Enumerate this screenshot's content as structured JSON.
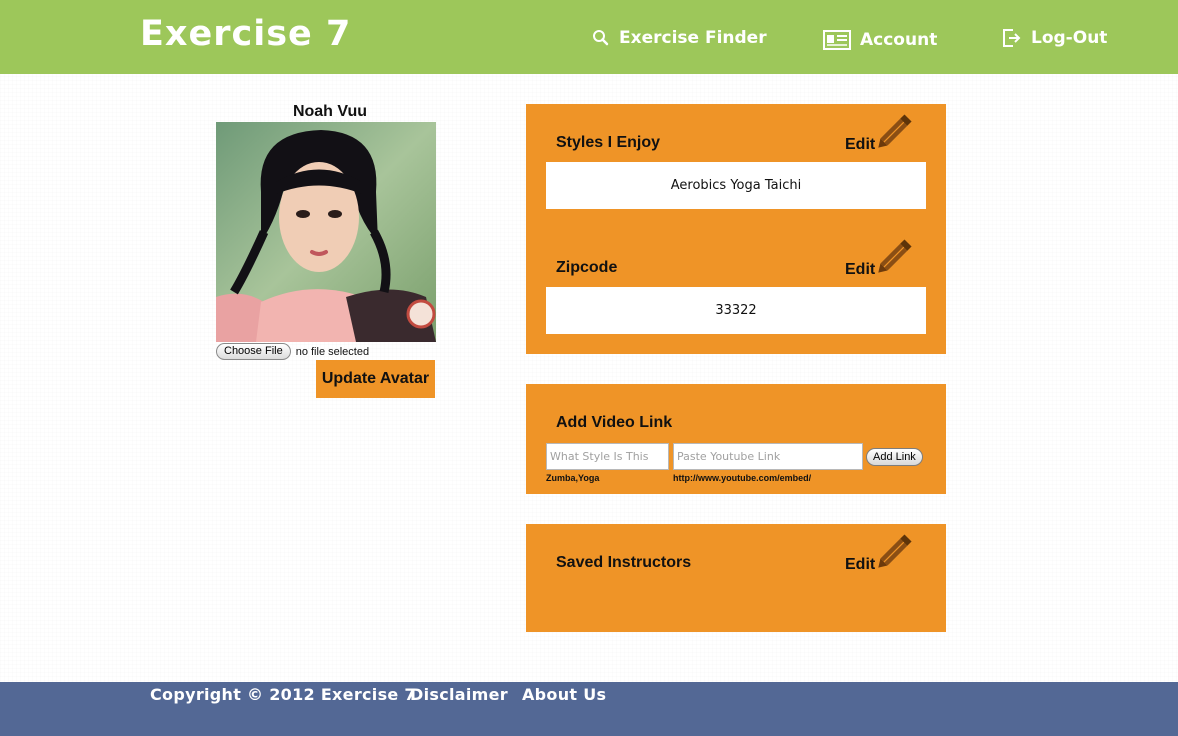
{
  "header": {
    "logo": "Exercise 7",
    "nav": [
      {
        "label": "Exercise Finder",
        "icon": "search-icon"
      },
      {
        "label": "Account",
        "icon": "id-card-icon"
      },
      {
        "label": "Log-Out",
        "icon": "logout-icon"
      }
    ]
  },
  "profile": {
    "name": "Noah Vuu",
    "file_button": "Choose File",
    "file_status": "no file selected",
    "update_button": "Update Avatar"
  },
  "styles_panel": {
    "title": "Styles I Enjoy",
    "edit": "Edit",
    "value": "Aerobics Yoga Taichi"
  },
  "zipcode_panel": {
    "title": "Zipcode",
    "edit": "Edit",
    "value": "33322"
  },
  "video_panel": {
    "title": "Add Video Link",
    "style_placeholder": "What Style Is This",
    "link_placeholder": "Paste Youtube Link",
    "add_button": "Add Link",
    "style_hint": "Zumba,Yoga",
    "link_hint": "http://www.youtube.com/embed/"
  },
  "instructors_panel": {
    "title": "Saved Instructors",
    "edit": "Edit"
  },
  "footer": {
    "copyright": "Copyright © 2012 Exercise 7",
    "disclaimer": "Disclaimer",
    "about": "About Us"
  },
  "colors": {
    "header_bg": "#9dc75a",
    "panel_bg": "#ef9427",
    "footer_bg": "#536895",
    "pencil": "#8a4e14"
  }
}
